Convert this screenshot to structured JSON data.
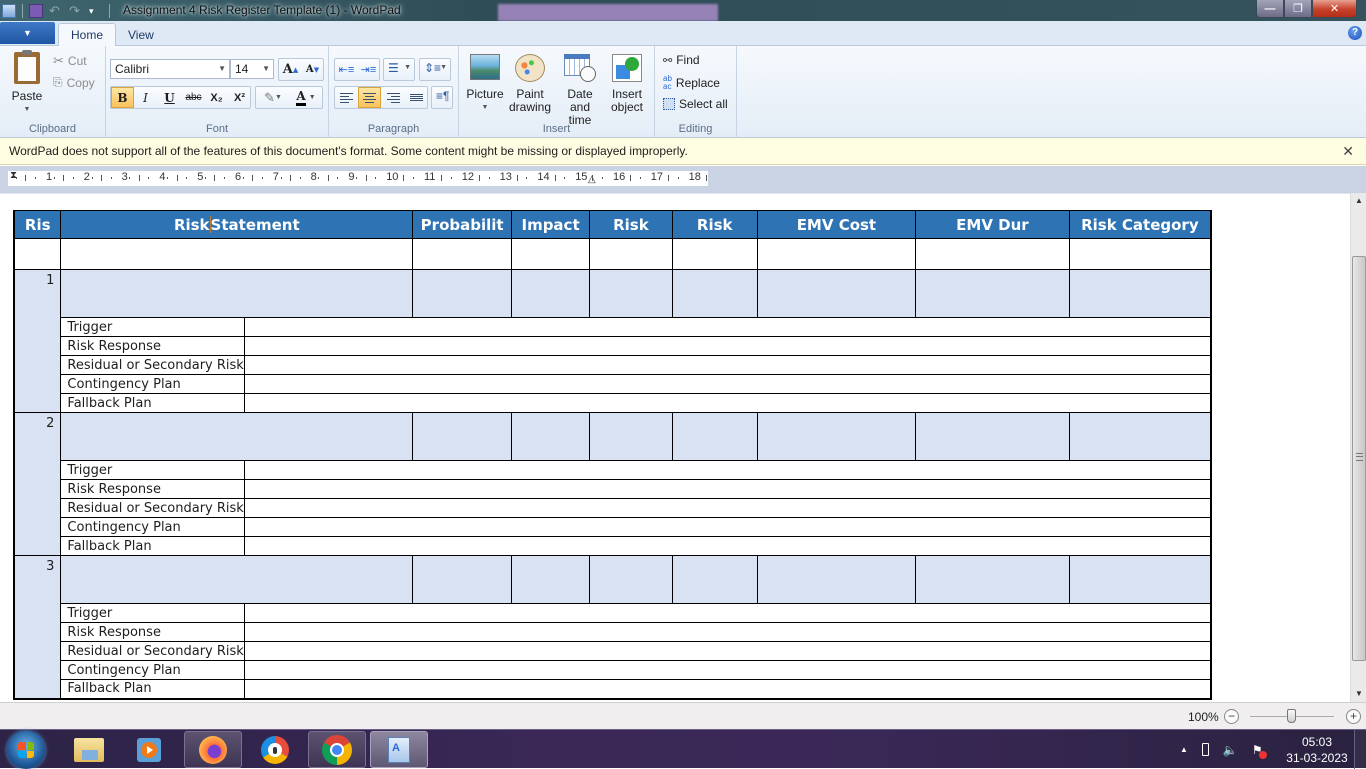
{
  "window": {
    "title": "Assignment 4 Risk Register Template (1) - WordPad",
    "controls": {
      "minimize": "—",
      "restore": "❐",
      "close": "✕"
    }
  },
  "ribbon": {
    "tabs": [
      {
        "label": "Home",
        "active": true
      },
      {
        "label": "View",
        "active": false
      }
    ],
    "help_icon": "?",
    "clipboard": {
      "label": "Clipboard",
      "paste": "Paste",
      "cut": "Cut",
      "copy": "Copy"
    },
    "font": {
      "label": "Font",
      "family": "Calibri",
      "size": "14",
      "grow": "A",
      "shrink": "A",
      "bold": "B",
      "italic": "I",
      "underline": "U",
      "strikethrough": "abc",
      "subscript": "X₂",
      "superscript": "X²",
      "text_color": "A",
      "bold_active": true
    },
    "paragraph": {
      "label": "Paragraph",
      "active_alignment": "center"
    },
    "insert": {
      "label": "Insert",
      "picture": "Picture",
      "paint_drawing": [
        "Paint",
        "drawing"
      ],
      "date_time": [
        "Date and",
        "time"
      ],
      "insert_object": [
        "Insert",
        "object"
      ]
    },
    "editing": {
      "label": "Editing",
      "find": "Find",
      "replace": "Replace",
      "select_all": "Select all"
    }
  },
  "infobar": {
    "message": "WordPad does not support all of the features of this document's format. Some content might be missing or displayed improperly.",
    "close": "✕"
  },
  "ruler": {
    "marks": [
      "1",
      "2",
      "3",
      "4",
      "5",
      "6",
      "7",
      "8",
      "9",
      "10",
      "11",
      "12",
      "13",
      "14",
      "15",
      "16",
      "17",
      "18"
    ]
  },
  "document": {
    "table": {
      "headers": [
        "Ris",
        "Risk",
        "Statement",
        "Probabilit",
        "Impact",
        "Risk",
        "Risk",
        "EMV Cost",
        "EMV Dur",
        "Risk Category"
      ],
      "risks": [
        {
          "number": "1",
          "sub_labels": [
            "Trigger",
            "Risk Response",
            "Residual or Secondary Risk",
            "Contingency Plan",
            "Fallback Plan"
          ]
        },
        {
          "number": "2",
          "sub_labels": [
            "Trigger",
            "Risk Response",
            "Residual or Secondary Risk",
            "Contingency Plan",
            "Fallback Plan"
          ]
        },
        {
          "number": "3",
          "sub_labels": [
            "Trigger",
            "Risk Response",
            "Residual or Secondary Risk",
            "Contingency Plan",
            "Fallback Plan"
          ]
        }
      ]
    },
    "colors": {
      "header_bg": "#2E74B5",
      "row_fill": "#D9E2F3"
    }
  },
  "statusbar": {
    "zoom": "100%",
    "zoom_out": "−",
    "zoom_in": "+",
    "zoom_level_percent": 100
  },
  "taskbar": {
    "apps": [
      "File Explorer",
      "Windows Media Player",
      "Firefox",
      "Browser",
      "Chrome",
      "WordPad"
    ],
    "clock_time": "05:03",
    "clock_date": "31-03-2023"
  }
}
